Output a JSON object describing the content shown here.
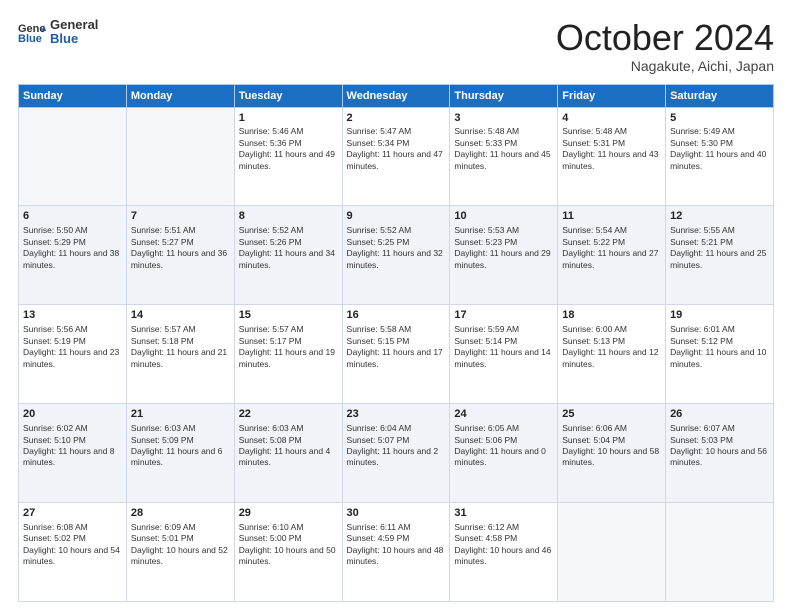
{
  "header": {
    "logo_line1": "General",
    "logo_line2": "Blue",
    "month": "October 2024",
    "location": "Nagakute, Aichi, Japan"
  },
  "weekdays": [
    "Sunday",
    "Monday",
    "Tuesday",
    "Wednesday",
    "Thursday",
    "Friday",
    "Saturday"
  ],
  "weeks": [
    [
      {
        "day": "",
        "sunrise": "",
        "sunset": "",
        "daylight": ""
      },
      {
        "day": "",
        "sunrise": "",
        "sunset": "",
        "daylight": ""
      },
      {
        "day": "1",
        "sunrise": "Sunrise: 5:46 AM",
        "sunset": "Sunset: 5:36 PM",
        "daylight": "Daylight: 11 hours and 49 minutes."
      },
      {
        "day": "2",
        "sunrise": "Sunrise: 5:47 AM",
        "sunset": "Sunset: 5:34 PM",
        "daylight": "Daylight: 11 hours and 47 minutes."
      },
      {
        "day": "3",
        "sunrise": "Sunrise: 5:48 AM",
        "sunset": "Sunset: 5:33 PM",
        "daylight": "Daylight: 11 hours and 45 minutes."
      },
      {
        "day": "4",
        "sunrise": "Sunrise: 5:48 AM",
        "sunset": "Sunset: 5:31 PM",
        "daylight": "Daylight: 11 hours and 43 minutes."
      },
      {
        "day": "5",
        "sunrise": "Sunrise: 5:49 AM",
        "sunset": "Sunset: 5:30 PM",
        "daylight": "Daylight: 11 hours and 40 minutes."
      }
    ],
    [
      {
        "day": "6",
        "sunrise": "Sunrise: 5:50 AM",
        "sunset": "Sunset: 5:29 PM",
        "daylight": "Daylight: 11 hours and 38 minutes."
      },
      {
        "day": "7",
        "sunrise": "Sunrise: 5:51 AM",
        "sunset": "Sunset: 5:27 PM",
        "daylight": "Daylight: 11 hours and 36 minutes."
      },
      {
        "day": "8",
        "sunrise": "Sunrise: 5:52 AM",
        "sunset": "Sunset: 5:26 PM",
        "daylight": "Daylight: 11 hours and 34 minutes."
      },
      {
        "day": "9",
        "sunrise": "Sunrise: 5:52 AM",
        "sunset": "Sunset: 5:25 PM",
        "daylight": "Daylight: 11 hours and 32 minutes."
      },
      {
        "day": "10",
        "sunrise": "Sunrise: 5:53 AM",
        "sunset": "Sunset: 5:23 PM",
        "daylight": "Daylight: 11 hours and 29 minutes."
      },
      {
        "day": "11",
        "sunrise": "Sunrise: 5:54 AM",
        "sunset": "Sunset: 5:22 PM",
        "daylight": "Daylight: 11 hours and 27 minutes."
      },
      {
        "day": "12",
        "sunrise": "Sunrise: 5:55 AM",
        "sunset": "Sunset: 5:21 PM",
        "daylight": "Daylight: 11 hours and 25 minutes."
      }
    ],
    [
      {
        "day": "13",
        "sunrise": "Sunrise: 5:56 AM",
        "sunset": "Sunset: 5:19 PM",
        "daylight": "Daylight: 11 hours and 23 minutes."
      },
      {
        "day": "14",
        "sunrise": "Sunrise: 5:57 AM",
        "sunset": "Sunset: 5:18 PM",
        "daylight": "Daylight: 11 hours and 21 minutes."
      },
      {
        "day": "15",
        "sunrise": "Sunrise: 5:57 AM",
        "sunset": "Sunset: 5:17 PM",
        "daylight": "Daylight: 11 hours and 19 minutes."
      },
      {
        "day": "16",
        "sunrise": "Sunrise: 5:58 AM",
        "sunset": "Sunset: 5:15 PM",
        "daylight": "Daylight: 11 hours and 17 minutes."
      },
      {
        "day": "17",
        "sunrise": "Sunrise: 5:59 AM",
        "sunset": "Sunset: 5:14 PM",
        "daylight": "Daylight: 11 hours and 14 minutes."
      },
      {
        "day": "18",
        "sunrise": "Sunrise: 6:00 AM",
        "sunset": "Sunset: 5:13 PM",
        "daylight": "Daylight: 11 hours and 12 minutes."
      },
      {
        "day": "19",
        "sunrise": "Sunrise: 6:01 AM",
        "sunset": "Sunset: 5:12 PM",
        "daylight": "Daylight: 11 hours and 10 minutes."
      }
    ],
    [
      {
        "day": "20",
        "sunrise": "Sunrise: 6:02 AM",
        "sunset": "Sunset: 5:10 PM",
        "daylight": "Daylight: 11 hours and 8 minutes."
      },
      {
        "day": "21",
        "sunrise": "Sunrise: 6:03 AM",
        "sunset": "Sunset: 5:09 PM",
        "daylight": "Daylight: 11 hours and 6 minutes."
      },
      {
        "day": "22",
        "sunrise": "Sunrise: 6:03 AM",
        "sunset": "Sunset: 5:08 PM",
        "daylight": "Daylight: 11 hours and 4 minutes."
      },
      {
        "day": "23",
        "sunrise": "Sunrise: 6:04 AM",
        "sunset": "Sunset: 5:07 PM",
        "daylight": "Daylight: 11 hours and 2 minutes."
      },
      {
        "day": "24",
        "sunrise": "Sunrise: 6:05 AM",
        "sunset": "Sunset: 5:06 PM",
        "daylight": "Daylight: 11 hours and 0 minutes."
      },
      {
        "day": "25",
        "sunrise": "Sunrise: 6:06 AM",
        "sunset": "Sunset: 5:04 PM",
        "daylight": "Daylight: 10 hours and 58 minutes."
      },
      {
        "day": "26",
        "sunrise": "Sunrise: 6:07 AM",
        "sunset": "Sunset: 5:03 PM",
        "daylight": "Daylight: 10 hours and 56 minutes."
      }
    ],
    [
      {
        "day": "27",
        "sunrise": "Sunrise: 6:08 AM",
        "sunset": "Sunset: 5:02 PM",
        "daylight": "Daylight: 10 hours and 54 minutes."
      },
      {
        "day": "28",
        "sunrise": "Sunrise: 6:09 AM",
        "sunset": "Sunset: 5:01 PM",
        "daylight": "Daylight: 10 hours and 52 minutes."
      },
      {
        "day": "29",
        "sunrise": "Sunrise: 6:10 AM",
        "sunset": "Sunset: 5:00 PM",
        "daylight": "Daylight: 10 hours and 50 minutes."
      },
      {
        "day": "30",
        "sunrise": "Sunrise: 6:11 AM",
        "sunset": "Sunset: 4:59 PM",
        "daylight": "Daylight: 10 hours and 48 minutes."
      },
      {
        "day": "31",
        "sunrise": "Sunrise: 6:12 AM",
        "sunset": "Sunset: 4:58 PM",
        "daylight": "Daylight: 10 hours and 46 minutes."
      },
      {
        "day": "",
        "sunrise": "",
        "sunset": "",
        "daylight": ""
      },
      {
        "day": "",
        "sunrise": "",
        "sunset": "",
        "daylight": ""
      }
    ]
  ]
}
